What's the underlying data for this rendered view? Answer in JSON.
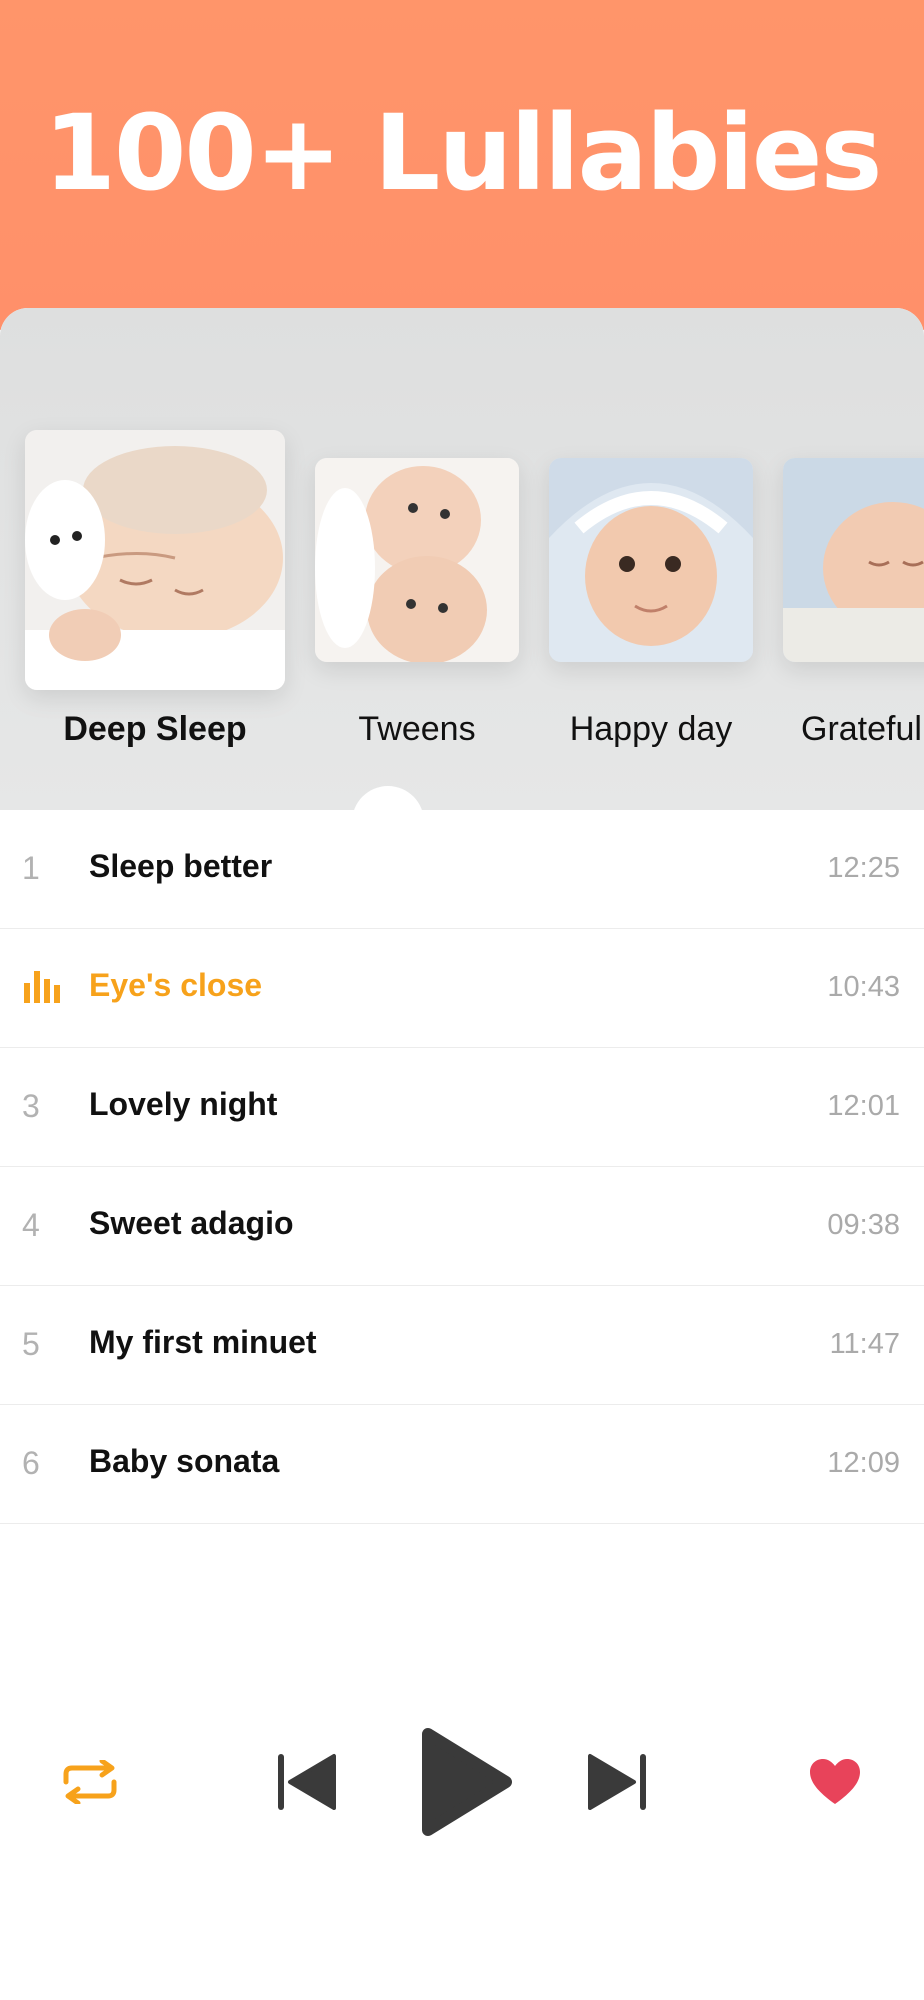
{
  "header": {
    "title": "100+ Lullabies"
  },
  "categories": [
    {
      "label": "Deep Sleep",
      "active": true
    },
    {
      "label": "Tweens",
      "active": false
    },
    {
      "label": "Happy day",
      "active": false
    },
    {
      "label": "Grateful",
      "active": false
    }
  ],
  "tracks": [
    {
      "number": "1",
      "title": "Sleep better",
      "duration": "12:25",
      "playing": false
    },
    {
      "number": "2",
      "title": "Eye's close",
      "duration": "10:43",
      "playing": true
    },
    {
      "number": "3",
      "title": "Lovely night",
      "duration": "12:01",
      "playing": false
    },
    {
      "number": "4",
      "title": "Sweet adagio",
      "duration": "09:38",
      "playing": false
    },
    {
      "number": "5",
      "title": "My first minuet",
      "duration": "11:47",
      "playing": false
    },
    {
      "number": "6",
      "title": "Baby sonata",
      "duration": "12:09",
      "playing": false
    }
  ],
  "player": {
    "repeat_icon": "repeat-icon",
    "previous_icon": "skip-previous-icon",
    "play_icon": "play-icon",
    "next_icon": "skip-next-icon",
    "favorite_icon": "heart-icon"
  },
  "colors": {
    "header_bg": "#ff936a",
    "accent": "#f7a21b",
    "favorite": "#e8435a",
    "control": "#3a3a3a"
  }
}
